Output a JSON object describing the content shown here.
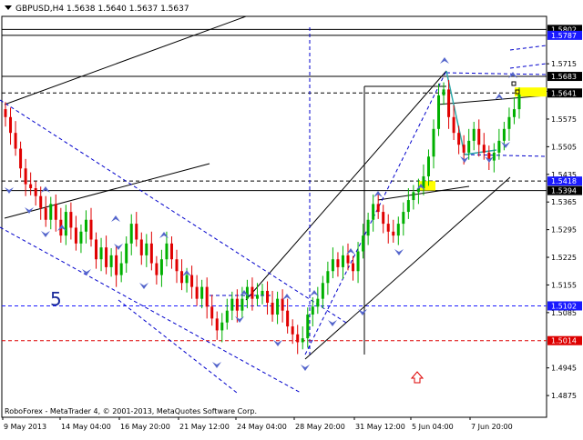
{
  "header": {
    "symbol_line": "GBPUSD,H4  1.5638 1.5640 1.5637 1.5637"
  },
  "footer": {
    "copyright": "RoboForex - MetaTrader 4, © 2001-2013, MetaQuotes Software Corp."
  },
  "annotations": {
    "wave_label": "5"
  },
  "colors": {
    "background": "#ffffff",
    "bull_candle": "#00b000",
    "bear_candle": "#e00000",
    "trendline": "#000000",
    "channel_dashed": "#0000cc",
    "level_blue": "#1a1aff",
    "level_red": "#dd0000",
    "target_highlight": "#ffff00",
    "arrow_marker": "#5566cc",
    "up_arrow": "#dd0000"
  },
  "chart_data": {
    "type": "candlestick",
    "symbol": "GBPUSD",
    "timeframe": "H4",
    "last_quote": {
      "open": 1.5638,
      "high": 1.564,
      "low": 1.5637,
      "close": 1.5637
    },
    "ylim": [
      1.482,
      1.5835
    ],
    "y_ticks": [
      "1.5715",
      "1.5645",
      "1.5575",
      "1.5505",
      "1.5435",
      "1.5365",
      "1.5295",
      "1.5225",
      "1.5155",
      "1.5085",
      "1.4945",
      "1.4875"
    ],
    "x_ticks": [
      "9 May 2013",
      "14 May 04:00",
      "16 May 20:00",
      "21 May 12:00",
      "24 May 04:00",
      "28 May 20:00",
      "31 May 12:00",
      "5 Jun 04:00",
      "7 Jun 20:00"
    ],
    "price_labels": [
      {
        "text": "1.5802",
        "value": 1.5802,
        "style": "black"
      },
      {
        "text": "1.5787",
        "value": 1.5787,
        "style": "blue"
      },
      {
        "text": "1.5683",
        "value": 1.5683,
        "style": "black"
      },
      {
        "text": "1.5641",
        "value": 1.5641,
        "style": "black"
      },
      {
        "text": "1.5418",
        "value": 1.5418,
        "style": "blue"
      },
      {
        "text": "1.5394",
        "value": 1.5394,
        "style": "black"
      },
      {
        "text": "1.5102",
        "value": 1.5102,
        "style": "blue"
      },
      {
        "text": "1.5014",
        "value": 1.5014,
        "style": "red"
      }
    ],
    "levels": [
      {
        "value": 1.5802,
        "style": "solid"
      },
      {
        "value": 1.5787,
        "style": "solid"
      },
      {
        "value": 1.5683,
        "style": "solid"
      },
      {
        "value": 1.5641,
        "style": "dashed"
      },
      {
        "value": 1.5418,
        "style": "dashed"
      },
      {
        "value": 1.5394,
        "style": "solid"
      },
      {
        "value": 1.5102,
        "style": "dashed-blue"
      },
      {
        "value": 1.5014,
        "style": "dashed-red"
      }
    ],
    "closes": [
      1.558,
      1.554,
      1.55,
      1.545,
      1.541,
      1.54,
      1.538,
      1.535,
      1.532,
      1.536,
      1.532,
      1.528,
      1.534,
      1.53,
      1.526,
      1.529,
      1.532,
      1.527,
      1.522,
      1.525,
      1.52,
      1.523,
      1.518,
      1.521,
      1.526,
      1.531,
      1.527,
      1.523,
      1.526,
      1.521,
      1.518,
      1.522,
      1.526,
      1.522,
      1.519,
      1.516,
      1.518,
      1.515,
      1.512,
      1.515,
      1.51,
      1.507,
      1.504,
      1.506,
      1.509,
      1.512,
      1.509,
      1.512,
      1.515,
      1.512,
      1.513,
      1.514,
      1.511,
      1.508,
      1.512,
      1.509,
      1.505,
      1.503,
      1.501,
      1.502,
      1.508,
      1.51,
      1.512,
      1.516,
      1.519,
      1.522,
      1.52,
      1.523,
      1.521,
      1.519,
      1.524,
      1.528,
      1.532,
      1.536,
      1.534,
      1.531,
      1.529,
      1.528,
      1.531,
      1.534,
      1.537,
      1.539,
      1.54,
      1.543,
      1.548,
      1.555,
      1.5635,
      1.565,
      1.558,
      1.554,
      1.551,
      1.549,
      1.552,
      1.555,
      1.551,
      1.549,
      1.547,
      1.549,
      1.552,
      1.555,
      1.558,
      1.56,
      1.5637
    ]
  }
}
